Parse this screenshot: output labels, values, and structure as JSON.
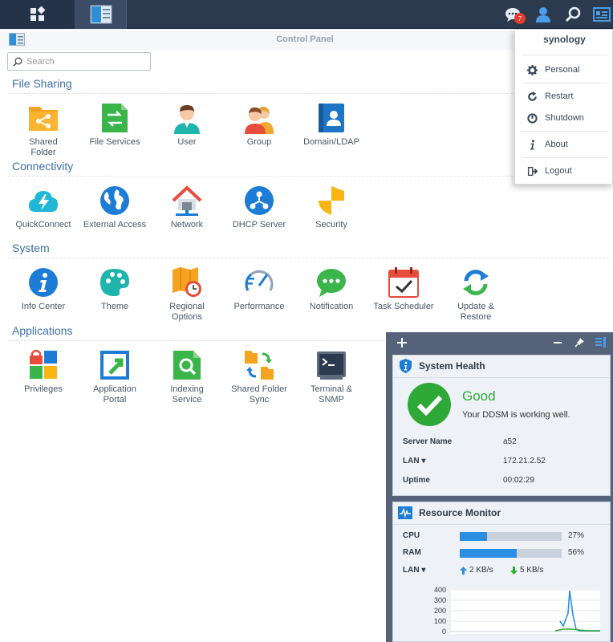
{
  "window": {
    "title": "Control Panel"
  },
  "taskbar": {
    "notification_count": "7"
  },
  "search": {
    "placeholder": "Search"
  },
  "sections": [
    {
      "title": "File Sharing",
      "apps": [
        "Shared\nFolder",
        "File Services",
        "User",
        "Group",
        "Domain/LDAP"
      ]
    },
    {
      "title": "Connectivity",
      "apps": [
        "QuickConnect",
        "External Access",
        "Network",
        "DHCP Server",
        "Security"
      ]
    },
    {
      "title": "System",
      "apps": [
        "Info Center",
        "Theme",
        "Regional\nOptions",
        "Performance",
        "Notification",
        "Task Scheduler",
        "Update &\nRestore"
      ]
    },
    {
      "title": "Applications",
      "apps": [
        "Privileges",
        "Application\nPortal",
        "Indexing\nService",
        "Shared Folder\nSync",
        "Terminal &\nSNMP"
      ]
    }
  ],
  "user_menu": {
    "username": "synology",
    "items": [
      "Personal",
      "Restart",
      "Shutdown",
      "About",
      "Logout"
    ]
  },
  "system_health": {
    "title": "System Health",
    "status": "Good",
    "message": "Your DDSM is working well.",
    "server_name_label": "Server Name",
    "server_name": "a52",
    "lan_label": "LAN ▾",
    "lan_ip": "172.21.2.52",
    "uptime_label": "Uptime",
    "uptime": "00:02:29"
  },
  "resource_monitor": {
    "title": "Resource Monitor",
    "cpu_label": "CPU",
    "cpu_percent": 27,
    "cpu_text": "27%",
    "ram_label": "RAM",
    "ram_percent": 56,
    "ram_text": "56%",
    "lan_label": "LAN ▾",
    "upload": "2 KB/s",
    "download": "5 KB/s",
    "chart_ticks": [
      "400",
      "300",
      "200",
      "100",
      "0"
    ]
  },
  "colors": {
    "taskbar": "#2b3a4e",
    "section_title": "#3a6fa8",
    "good_green": "#2ea836",
    "bar_blue": "#2c8ee3"
  }
}
